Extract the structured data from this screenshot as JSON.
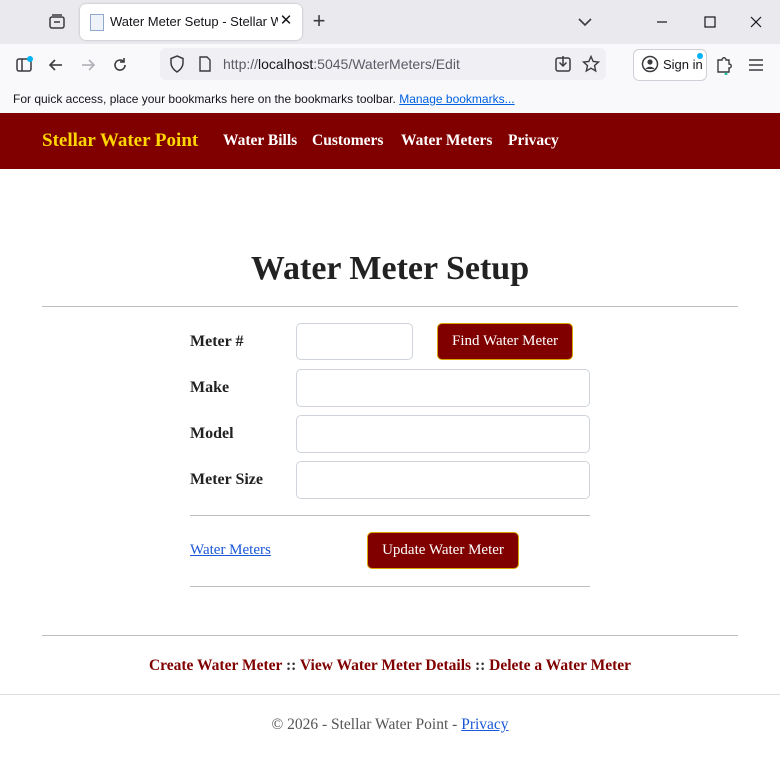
{
  "browser": {
    "tab_title": "Water Meter Setup - Stellar Water Point",
    "tab_close_glyph": "✕",
    "new_tab_glyph": "+",
    "url_scheme": "http://",
    "url_host": "localhost",
    "url_rest": ":5045/WaterMeters/Edit",
    "signin_label": "Sign in",
    "bookmarks_message": "For quick access, place your bookmarks here on the bookmarks toolbar.",
    "bookmarks_link": "Manage bookmarks..."
  },
  "site": {
    "brand": "Stellar Water Point",
    "nav": [
      "Water Bills",
      "Customers",
      "Water Meters",
      "Privacy"
    ]
  },
  "page": {
    "title": "Water Meter Setup",
    "form": {
      "meter_label": "Meter #",
      "make_label": "Make",
      "model_label": "Model",
      "size_label": "Meter Size",
      "meter_value": "",
      "make_value": "",
      "model_value": "",
      "size_value": "",
      "find_button": "Find Water Meter",
      "update_button": "Update Water Meter",
      "back_link": "Water Meters"
    },
    "bottom_links": {
      "create": "Create Water Meter",
      "details": "View Water Meter Details",
      "delete": "Delete a Water Meter",
      "separator": "::"
    },
    "footer": {
      "text": "© 2026 - Stellar Water Point - ",
      "privacy": "Privacy"
    }
  },
  "colors": {
    "brand_bar": "#800000",
    "brand_text": "#ffd700",
    "button_border": "#d9a400",
    "link": "#1a57d6"
  }
}
